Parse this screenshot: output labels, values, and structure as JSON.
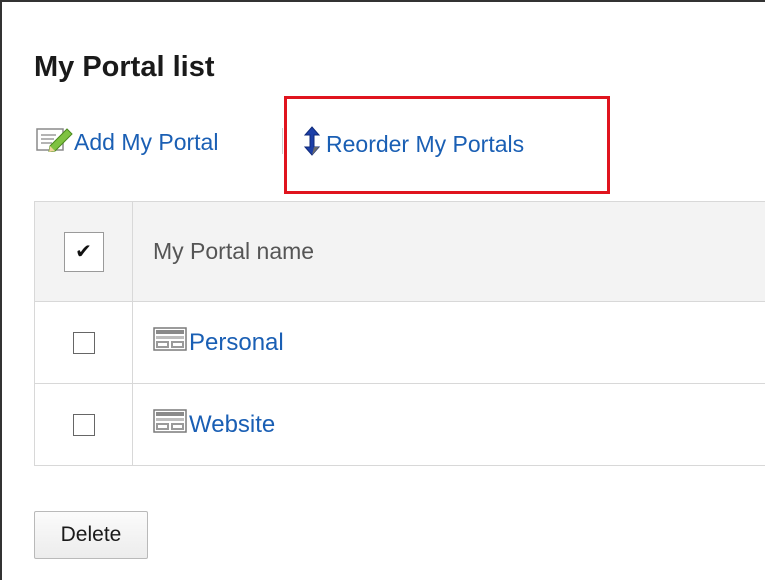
{
  "page": {
    "title": "My Portal list"
  },
  "actions": {
    "add_label": "Add My Portal",
    "reorder_label": "Reorder My Portals"
  },
  "table": {
    "header_name": "My Portal name",
    "header_check_mark": "✔",
    "rows": [
      {
        "name": "Personal",
        "checked": false
      },
      {
        "name": "Website",
        "checked": false
      }
    ]
  },
  "footer": {
    "delete_label": "Delete"
  },
  "colors": {
    "link": "#1a5fb4",
    "highlight": "#e0141e",
    "header_bg": "#f3f3f3"
  },
  "icons": {
    "add": "edit-note-icon",
    "reorder": "sort-arrows-icon",
    "portal": "portal-layout-icon"
  }
}
